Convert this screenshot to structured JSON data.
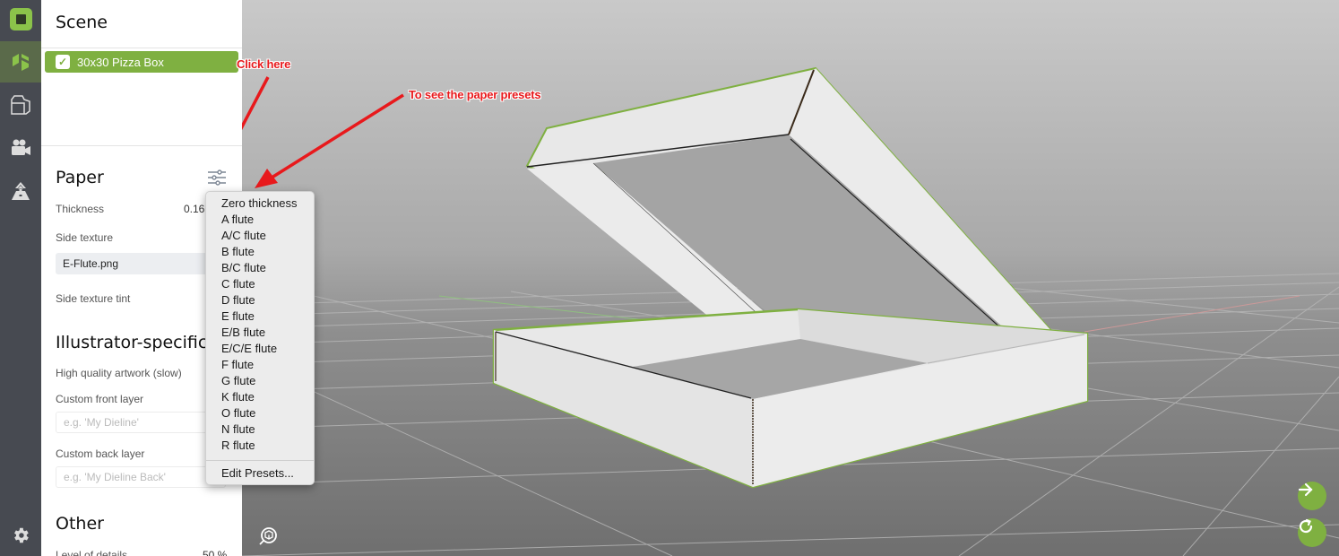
{
  "rail": {
    "items": [
      {
        "name": "logo",
        "icon": "app-logo-icon"
      },
      {
        "name": "scene",
        "icon": "scene-icon",
        "active": true
      },
      {
        "name": "dieline",
        "icon": "dieline-icon"
      },
      {
        "name": "camera",
        "icon": "camera-icon"
      },
      {
        "name": "export",
        "icon": "export-icon"
      },
      {
        "name": "settings",
        "icon": "gear-icon"
      }
    ]
  },
  "scene": {
    "title": "Scene",
    "items": [
      {
        "label": "30x30 Pizza Box",
        "checked": true
      }
    ]
  },
  "paper": {
    "title": "Paper",
    "thickness_label": "Thickness",
    "thickness_value": "0.16",
    "side_texture_label": "Side texture",
    "side_texture_value": "E-Flute.png",
    "side_texture_tint_label": "Side texture tint",
    "presets_icon": "sliders-icon"
  },
  "illustrator": {
    "title": "Illustrator-specific",
    "high_quality_label": "High quality artwork (slow)",
    "front_layer_label": "Custom front layer",
    "front_layer_placeholder": "e.g. 'My Dieline'",
    "back_layer_label": "Custom back layer",
    "back_layer_placeholder": "e.g. 'My Dieline Back'"
  },
  "other": {
    "title": "Other",
    "level_of_details_label": "Level of details",
    "level_of_details_value": "50 %"
  },
  "presets_menu": {
    "items": [
      "Zero thickness",
      "A flute",
      "A/C flute",
      "B flute",
      "B/C flute",
      "C flute",
      "D flute",
      "E flute",
      "E/B flute",
      "E/C/E flute",
      "F flute",
      "G flute",
      "K flute",
      "O flute",
      "N flute",
      "R flute"
    ],
    "footer": "Edit Presets..."
  },
  "annotations": {
    "click_here": "Click here",
    "see_presets": "To see the paper presets"
  },
  "viewport": {
    "accent_color": "#7fb041",
    "next_icon": "arrow-right-icon",
    "reset_icon": "refresh-icon",
    "view_icon": "cube-view-icon"
  }
}
